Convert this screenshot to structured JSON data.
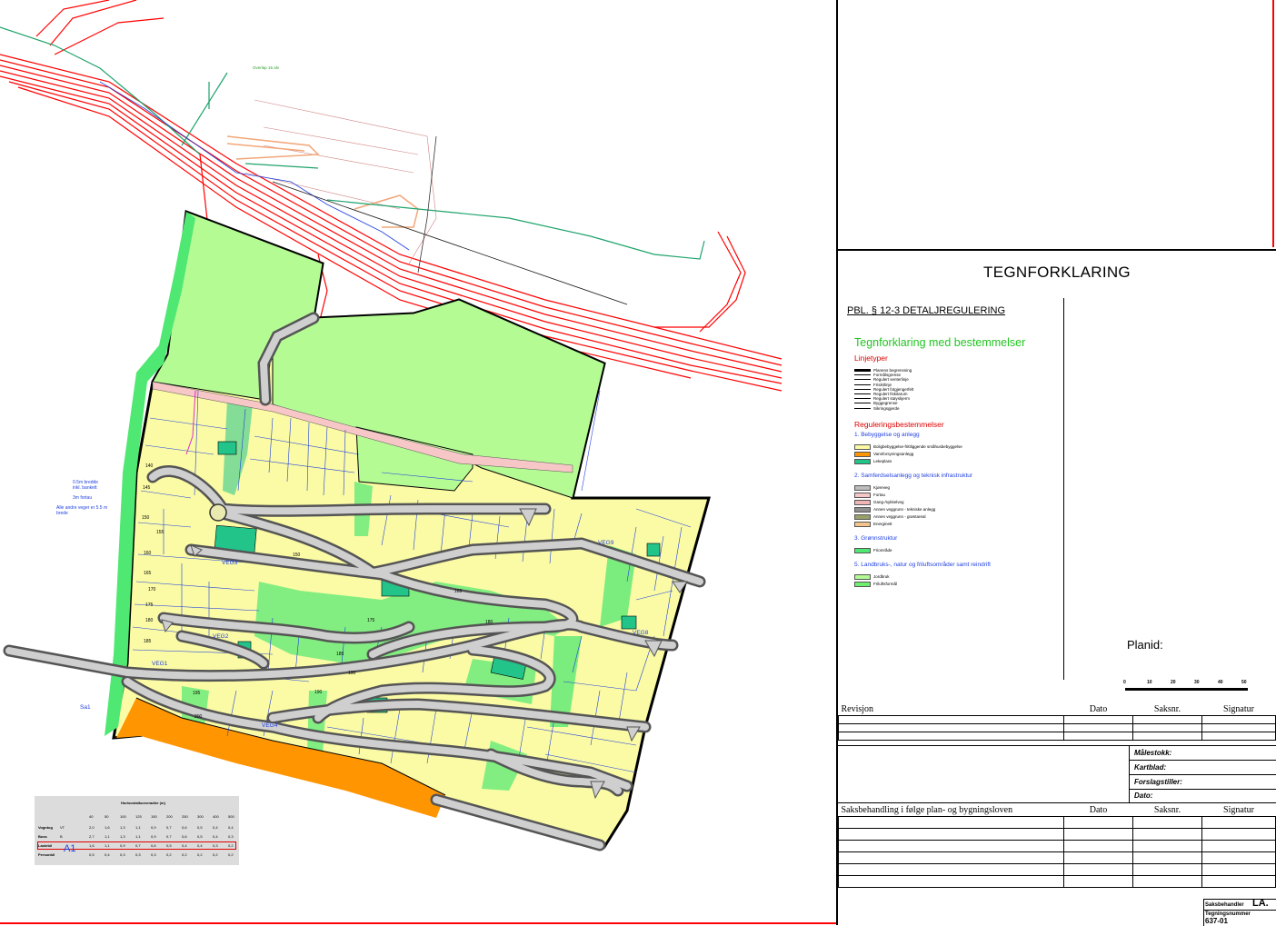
{
  "legend": {
    "title": "TEGNFORKLARING",
    "pbl": "PBL. § 12-3 DETALJREGULERING",
    "heading": "Tegnforklaring med bestemmelser",
    "linjetyper_title": "Linjetyper",
    "linjetyper": [
      "Planens begrensning",
      "Formålsgrense",
      "Regulert senterlinje",
      "Frisiktlinje",
      "Regulert fotgjengerfelt",
      "Regulert fiskitarum",
      "Regulert støyskjerm",
      "Byggegrense",
      "Sikringsgjerde"
    ],
    "regulering_title": "Reguleringsbestemmelser",
    "sections": [
      {
        "title": "1. Bebyggelse og anlegg",
        "items": [
          {
            "label": "Boligbebyggelse-frittliggende småhusbebyggelse",
            "color": "#fbfba5"
          },
          {
            "label": "Vannforsyningsanlegg",
            "color": "#ff9500"
          },
          {
            "label": "Lekeplass",
            "color": "#22c48a"
          }
        ]
      },
      {
        "title": "2. Samferdselsanlegg og teknisk infrastruktur",
        "items": [
          {
            "label": "Kjøreveg",
            "color": "#bdbdbd"
          },
          {
            "label": "Fortau",
            "color": "#f7c6c6"
          },
          {
            "label": "Gang-/sykkelveg",
            "color": "#f0b6b6"
          },
          {
            "label": "Annen veggrunn - tekniske anlegg",
            "color": "#8f8f8f"
          },
          {
            "label": "Annen veggrunn - grøntareal",
            "color": "#9aa06a"
          },
          {
            "label": "Energinett",
            "color": "#f4c48c"
          }
        ]
      },
      {
        "title": "3. Grønnstruktur",
        "items": [
          {
            "label": "Friområde",
            "color": "#4fe872"
          }
        ]
      },
      {
        "title": "5. Landbruks-, natur og friluftsområder samt reindrift",
        "items": [
          {
            "label": "Jordbruk",
            "color": "#b5fb94"
          },
          {
            "label": "Friluftsformål",
            "color": "#6fef6f"
          }
        ]
      }
    ],
    "planid_label": "Planid:",
    "scale_labels": [
      "0",
      "10",
      "20",
      "30",
      "40",
      "50"
    ]
  },
  "revisjon": {
    "headers": [
      "Revisjon",
      "Dato",
      "Saksnr.",
      "Signatur"
    ]
  },
  "meta_labels": [
    "Målestokk:",
    "Kartblad:",
    "Forslagstiller:",
    "Dato:"
  ],
  "saksbehandling": {
    "headers": [
      "Saksbehandling i følge plan- og bygningsloven",
      "Dato",
      "Saksnr.",
      "Signatur"
    ]
  },
  "footer": {
    "saksbehandler_label": "Saksbehandler",
    "saksbehandler_value": "LA.",
    "tegningsnummer_label": "Tegningsnummer",
    "tegningsnummer_value": "637-01"
  },
  "map_labels": {
    "veg1": "VEG1",
    "veg2": "VEG2",
    "veg3": "VEG3",
    "veg4": "VEG4",
    "veg8": "VEG8",
    "veg9": "VEG9",
    "sa1": "Sa1",
    "note1": "0.5m bredde",
    "note2": "inkl. bankett",
    "note3": "3m fortau",
    "note4": "Alle andre veger er 5.5 m",
    "note5": "brede",
    "overlap": "Overlap 16 alv",
    "kote": [
      "140",
      "145",
      "150",
      "155",
      "160",
      "165",
      "170",
      "175",
      "180",
      "185",
      "190",
      "195",
      "200",
      "165",
      "180",
      "185",
      "190",
      "175"
    ]
  },
  "radius_table": {
    "title": "Horisontalkurveradier (m)",
    "columns": [
      "40",
      "50",
      "100",
      "125",
      "150",
      "200",
      "250",
      "300",
      "400",
      "500"
    ],
    "rows": [
      {
        "label": "Vogntog",
        "code": "VT",
        "values": [
          "2,0",
          "1,6",
          "1,3",
          "1,1",
          "0,9",
          "0,7",
          "0,6",
          "0,5",
          "0,4",
          "0,4"
        ]
      },
      {
        "label": "Buss",
        "code": "B",
        "values": [
          "2,7",
          "1,1",
          "1,3",
          "1,1",
          "0,9",
          "0,7",
          "0,6",
          "0,5",
          "0,4",
          "0,3"
        ]
      },
      {
        "label": "Lastebil",
        "code": "",
        "values": [
          "1,6",
          "1,1",
          "0,9",
          "0,7",
          "0,6",
          "0,5",
          "0,4",
          "0,4",
          "0,3",
          "0,2"
        ]
      },
      {
        "label": "Personbil",
        "code": "",
        "values": [
          "0,5",
          "0,4",
          "0,3",
          "0,3",
          "0,3",
          "0,2",
          "0,2",
          "0,2",
          "0,2",
          "0,2"
        ]
      }
    ],
    "highlight": "A1"
  }
}
